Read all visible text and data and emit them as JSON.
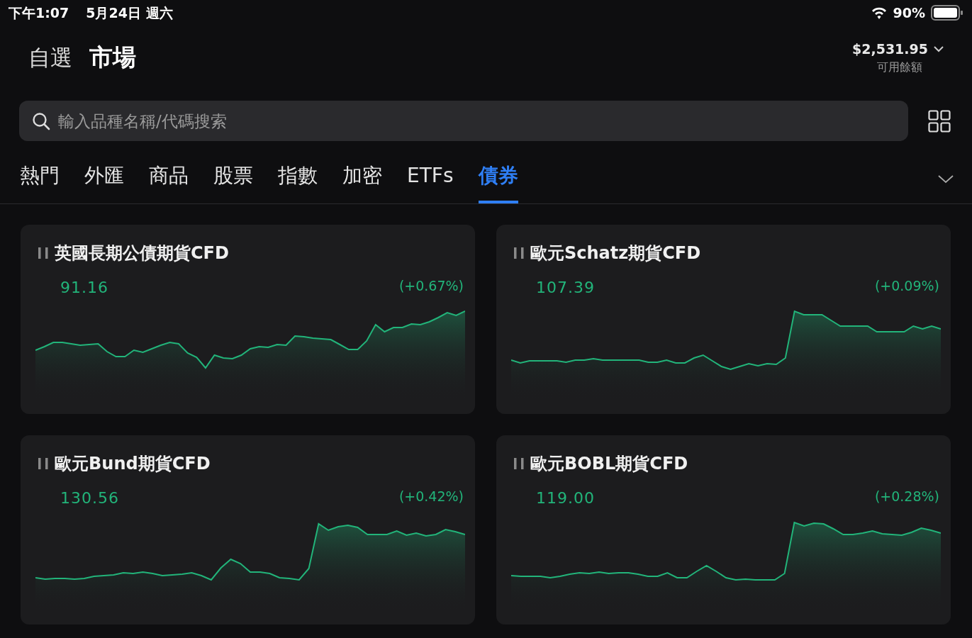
{
  "status_bar": {
    "time": "下午1:07",
    "date": "5月24日 週六",
    "battery": "90%"
  },
  "header": {
    "tabs": [
      {
        "label": "自選",
        "selected": false
      },
      {
        "label": "市場",
        "selected": true
      }
    ],
    "balance": {
      "amount": "$2,531.95",
      "label": "可用餘額"
    }
  },
  "search": {
    "placeholder": "輸入品種名稱/代碼搜索"
  },
  "categories": [
    {
      "label": "熱門",
      "selected": false
    },
    {
      "label": "外匯",
      "selected": false
    },
    {
      "label": "商品",
      "selected": false
    },
    {
      "label": "股票",
      "selected": false
    },
    {
      "label": "指數",
      "selected": false
    },
    {
      "label": "加密",
      "selected": false
    },
    {
      "label": "ETFs",
      "selected": false
    },
    {
      "label": "債券",
      "selected": true
    }
  ],
  "instruments": [
    {
      "name": "英國長期公債期貨CFD",
      "price": "91.16",
      "change": "(+0.67%)"
    },
    {
      "name": "歐元Schatz期貨CFD",
      "price": "107.39",
      "change": "(+0.09%)"
    },
    {
      "name": "歐元Bund期貨CFD",
      "price": "130.56",
      "change": "(+0.42%)"
    },
    {
      "name": "歐元BOBL期貨CFD",
      "price": "119.00",
      "change": "(+0.28%)"
    }
  ]
}
